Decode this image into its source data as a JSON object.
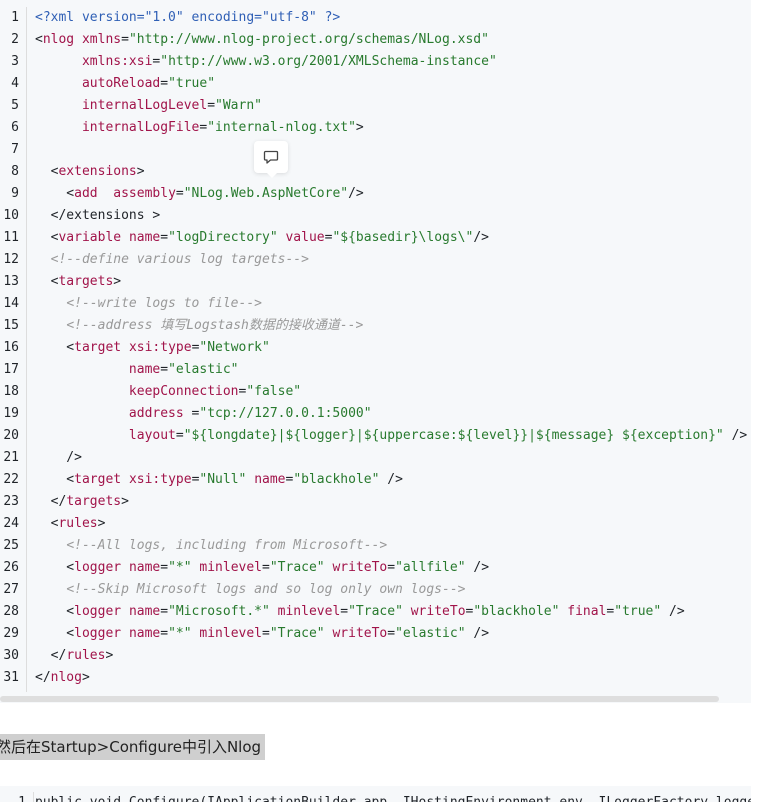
{
  "code_block": {
    "line_numbers": [
      "1",
      "2",
      "3",
      "4",
      "5",
      "6",
      "7",
      "8",
      "9",
      "10",
      "11",
      "12",
      "13",
      "14",
      "15",
      "16",
      "17",
      "18",
      "19",
      "20",
      "21",
      "22",
      "23",
      "24",
      "25",
      "26",
      "27",
      "28",
      "29",
      "30",
      "31"
    ],
    "lines": [
      [
        {
          "t": "pi",
          "s": "<?xml version=\"1.0\" encoding=\"utf-8\" ?>"
        }
      ],
      [
        {
          "t": "punct",
          "s": "<"
        },
        {
          "t": "tag",
          "s": "nlog"
        },
        {
          "t": "punct",
          "s": " "
        },
        {
          "t": "attr",
          "s": "xmlns"
        },
        {
          "t": "punct",
          "s": "="
        },
        {
          "t": "val",
          "s": "\"http://www.nlog-project.org/schemas/NLog.xsd\""
        }
      ],
      [
        {
          "t": "punct",
          "s": "      "
        },
        {
          "t": "attr",
          "s": "xmlns:xsi"
        },
        {
          "t": "punct",
          "s": "="
        },
        {
          "t": "val",
          "s": "\"http://www.w3.org/2001/XMLSchema-instance\""
        }
      ],
      [
        {
          "t": "punct",
          "s": "      "
        },
        {
          "t": "attr",
          "s": "autoReload"
        },
        {
          "t": "punct",
          "s": "="
        },
        {
          "t": "val",
          "s": "\"true\""
        }
      ],
      [
        {
          "t": "punct",
          "s": "      "
        },
        {
          "t": "attr",
          "s": "internalLogLevel"
        },
        {
          "t": "punct",
          "s": "="
        },
        {
          "t": "val",
          "s": "\"Warn\""
        }
      ],
      [
        {
          "t": "punct",
          "s": "      "
        },
        {
          "t": "attr",
          "s": "internalLogFile"
        },
        {
          "t": "punct",
          "s": "="
        },
        {
          "t": "val",
          "s": "\"internal-nlog.txt\""
        },
        {
          "t": "punct",
          "s": ">"
        }
      ],
      [
        {
          "t": "punct",
          "s": ""
        }
      ],
      [
        {
          "t": "punct",
          "s": "  <"
        },
        {
          "t": "tag",
          "s": "extensions"
        },
        {
          "t": "punct",
          "s": ">"
        }
      ],
      [
        {
          "t": "punct",
          "s": "    <"
        },
        {
          "t": "tag",
          "s": "add"
        },
        {
          "t": "punct",
          "s": "  "
        },
        {
          "t": "attr",
          "s": "assembly"
        },
        {
          "t": "punct",
          "s": "="
        },
        {
          "t": "val",
          "s": "\"NLog.Web.AspNetCore\""
        },
        {
          "t": "punct",
          "s": "/>"
        }
      ],
      [
        {
          "t": "punct",
          "s": "  </extensions >"
        }
      ],
      [
        {
          "t": "punct",
          "s": "  <"
        },
        {
          "t": "tag",
          "s": "variable"
        },
        {
          "t": "punct",
          "s": " "
        },
        {
          "t": "attr",
          "s": "name"
        },
        {
          "t": "punct",
          "s": "="
        },
        {
          "t": "val",
          "s": "\"logDirectory\""
        },
        {
          "t": "punct",
          "s": " "
        },
        {
          "t": "attr",
          "s": "value"
        },
        {
          "t": "punct",
          "s": "="
        },
        {
          "t": "val",
          "s": "\"${basedir}\\logs\\\""
        },
        {
          "t": "punct",
          "s": "/>"
        }
      ],
      [
        {
          "t": "punct",
          "s": "  "
        },
        {
          "t": "comment",
          "s": "<!--define various log targets-->"
        }
      ],
      [
        {
          "t": "punct",
          "s": "  <"
        },
        {
          "t": "tag",
          "s": "targets"
        },
        {
          "t": "punct",
          "s": ">"
        }
      ],
      [
        {
          "t": "punct",
          "s": "    "
        },
        {
          "t": "comment",
          "s": "<!--write logs to file-->"
        }
      ],
      [
        {
          "t": "punct",
          "s": "    "
        },
        {
          "t": "comment",
          "s": "<!--address 填写Logstash数据的接收通道-->"
        }
      ],
      [
        {
          "t": "punct",
          "s": "    <"
        },
        {
          "t": "tag",
          "s": "target"
        },
        {
          "t": "punct",
          "s": " "
        },
        {
          "t": "attr",
          "s": "xsi:type"
        },
        {
          "t": "punct",
          "s": "="
        },
        {
          "t": "val",
          "s": "\"Network\""
        }
      ],
      [
        {
          "t": "punct",
          "s": "            "
        },
        {
          "t": "attr",
          "s": "name"
        },
        {
          "t": "punct",
          "s": "="
        },
        {
          "t": "val",
          "s": "\"elastic\""
        }
      ],
      [
        {
          "t": "punct",
          "s": "            "
        },
        {
          "t": "attr",
          "s": "keepConnection"
        },
        {
          "t": "punct",
          "s": "="
        },
        {
          "t": "val",
          "s": "\"false\""
        }
      ],
      [
        {
          "t": "punct",
          "s": "            "
        },
        {
          "t": "attr",
          "s": "address"
        },
        {
          "t": "punct",
          "s": " ="
        },
        {
          "t": "val",
          "s": "\"tcp://127.0.0.1:5000\""
        }
      ],
      [
        {
          "t": "punct",
          "s": "            "
        },
        {
          "t": "attr",
          "s": "layout"
        },
        {
          "t": "punct",
          "s": "="
        },
        {
          "t": "val",
          "s": "\"${longdate}|${logger}|${uppercase:${level}}|${message} ${exception}\""
        },
        {
          "t": "punct",
          "s": " />"
        }
      ],
      [
        {
          "t": "punct",
          "s": "    />"
        }
      ],
      [
        {
          "t": "punct",
          "s": "    <"
        },
        {
          "t": "tag",
          "s": "target"
        },
        {
          "t": "punct",
          "s": " "
        },
        {
          "t": "attr",
          "s": "xsi:type"
        },
        {
          "t": "punct",
          "s": "="
        },
        {
          "t": "val",
          "s": "\"Null\""
        },
        {
          "t": "punct",
          "s": " "
        },
        {
          "t": "attr",
          "s": "name"
        },
        {
          "t": "punct",
          "s": "="
        },
        {
          "t": "val",
          "s": "\"blackhole\""
        },
        {
          "t": "punct",
          "s": " />"
        }
      ],
      [
        {
          "t": "punct",
          "s": "  </"
        },
        {
          "t": "tag",
          "s": "targets"
        },
        {
          "t": "punct",
          "s": ">"
        }
      ],
      [
        {
          "t": "punct",
          "s": "  <"
        },
        {
          "t": "tag",
          "s": "rules"
        },
        {
          "t": "punct",
          "s": ">"
        }
      ],
      [
        {
          "t": "punct",
          "s": "    "
        },
        {
          "t": "comment",
          "s": "<!--All logs, including from Microsoft-->"
        }
      ],
      [
        {
          "t": "punct",
          "s": "    <"
        },
        {
          "t": "tag",
          "s": "logger"
        },
        {
          "t": "punct",
          "s": " "
        },
        {
          "t": "attr",
          "s": "name"
        },
        {
          "t": "punct",
          "s": "="
        },
        {
          "t": "val",
          "s": "\"*\""
        },
        {
          "t": "punct",
          "s": " "
        },
        {
          "t": "attr",
          "s": "minlevel"
        },
        {
          "t": "punct",
          "s": "="
        },
        {
          "t": "val",
          "s": "\"Trace\""
        },
        {
          "t": "punct",
          "s": " "
        },
        {
          "t": "attr",
          "s": "writeTo"
        },
        {
          "t": "punct",
          "s": "="
        },
        {
          "t": "val",
          "s": "\"allfile\""
        },
        {
          "t": "punct",
          "s": " />"
        }
      ],
      [
        {
          "t": "punct",
          "s": "    "
        },
        {
          "t": "comment",
          "s": "<!--Skip Microsoft logs and so log only own logs-->"
        }
      ],
      [
        {
          "t": "punct",
          "s": "    <"
        },
        {
          "t": "tag",
          "s": "logger"
        },
        {
          "t": "punct",
          "s": " "
        },
        {
          "t": "attr",
          "s": "name"
        },
        {
          "t": "punct",
          "s": "="
        },
        {
          "t": "val",
          "s": "\"Microsoft.*\""
        },
        {
          "t": "punct",
          "s": " "
        },
        {
          "t": "attr",
          "s": "minlevel"
        },
        {
          "t": "punct",
          "s": "="
        },
        {
          "t": "val",
          "s": "\"Trace\""
        },
        {
          "t": "punct",
          "s": " "
        },
        {
          "t": "attr",
          "s": "writeTo"
        },
        {
          "t": "punct",
          "s": "="
        },
        {
          "t": "val",
          "s": "\"blackhole\""
        },
        {
          "t": "punct",
          "s": " "
        },
        {
          "t": "attr",
          "s": "final"
        },
        {
          "t": "punct",
          "s": "="
        },
        {
          "t": "val",
          "s": "\"true\""
        },
        {
          "t": "punct",
          "s": " />"
        }
      ],
      [
        {
          "t": "punct",
          "s": "    <"
        },
        {
          "t": "tag",
          "s": "logger"
        },
        {
          "t": "punct",
          "s": " "
        },
        {
          "t": "attr",
          "s": "name"
        },
        {
          "t": "punct",
          "s": "="
        },
        {
          "t": "val",
          "s": "\"*\""
        },
        {
          "t": "punct",
          "s": " "
        },
        {
          "t": "attr",
          "s": "minlevel"
        },
        {
          "t": "punct",
          "s": "="
        },
        {
          "t": "val",
          "s": "\"Trace\""
        },
        {
          "t": "punct",
          "s": " "
        },
        {
          "t": "attr",
          "s": "writeTo"
        },
        {
          "t": "punct",
          "s": "="
        },
        {
          "t": "val",
          "s": "\"elastic\""
        },
        {
          "t": "punct",
          "s": " />"
        }
      ],
      [
        {
          "t": "punct",
          "s": "  </"
        },
        {
          "t": "tag",
          "s": "rules"
        },
        {
          "t": "punct",
          "s": ">"
        }
      ],
      [
        {
          "t": "punct",
          "s": "</"
        },
        {
          "t": "tag",
          "s": "nlog"
        },
        {
          "t": "punct",
          "s": ">"
        }
      ]
    ]
  },
  "comment_button": {
    "icon": "comment-icon"
  },
  "paragraph": {
    "text": "然后在Startup>Configure中引入Nlog"
  },
  "code_block_2": {
    "line_number": "1",
    "text": "public void Configure(IApplicationBuilder app, IHostingEnvironment env, ILoggerFactory logger"
  },
  "colors": {
    "code_background": "#f6f8fa",
    "tag": "#a1144a",
    "string": "#287a2e",
    "comment": "#999999",
    "xml_declaration": "#2f5fb5"
  }
}
